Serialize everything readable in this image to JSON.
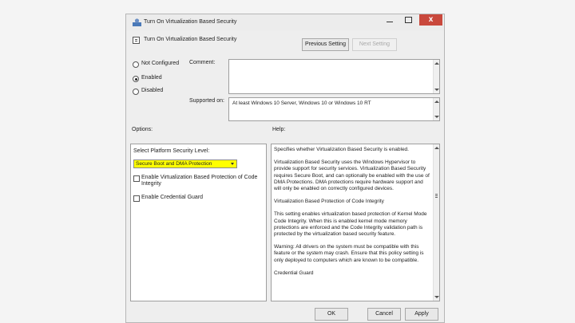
{
  "window": {
    "title": "Turn On Virtualization Based Security",
    "controls": {
      "minimize": "minimize",
      "maximize": "maximize",
      "close": "x"
    }
  },
  "header": {
    "policy_title": "Turn On Virtualization Based Security",
    "previous_label": "Previous Setting",
    "next_label": "Next Setting"
  },
  "state": {
    "options": [
      {
        "label": "Not Configured",
        "selected": false
      },
      {
        "label": "Enabled",
        "selected": true
      },
      {
        "label": "Disabled",
        "selected": false
      }
    ]
  },
  "comment": {
    "label": "Comment:",
    "value": ""
  },
  "supported": {
    "label": "Supported on:",
    "value": "At least Windows 10 Server, Windows 10 or Windows 10 RT"
  },
  "options_panel": {
    "heading": "Options:",
    "platform_label": "Select Platform Security Level:",
    "platform_value": "Secure Boot and DMA Protection",
    "code_integrity_label": "Enable Virtualization Based Protection of Code Integrity",
    "code_integrity_checked": false,
    "credential_guard_label": "Enable Credential Guard",
    "credential_guard_checked": false
  },
  "help_panel": {
    "heading": "Help:",
    "paragraphs": [
      "Specifies whether Virtualization Based Security is enabled.",
      "Virtualization Based Security uses the Windows Hypervisor to provide support for security services.  Virtualization Based Security requires Secure Boot, and can optionally be enabled with the use of DMA Protections.  DMA protections require hardware support and will only be enabled on correctly configured devices.",
      "Virtualization Based Protection of Code Integrity",
      "This setting enables virtualization based protection of Kernel Mode Code Integrity. When this is enabled kernel mode memory protections are enforced and the Code Integrity validation path is protected by the virtualization based security feature.",
      "Warning: All drivers on the system must be compatible with this feature or the system may crash. Ensure that this policy setting is only deployed to computers which are known to be compatible.",
      "Credential Guard"
    ]
  },
  "footer": {
    "ok_label": "OK",
    "cancel_label": "Cancel",
    "apply_label": "Apply"
  }
}
